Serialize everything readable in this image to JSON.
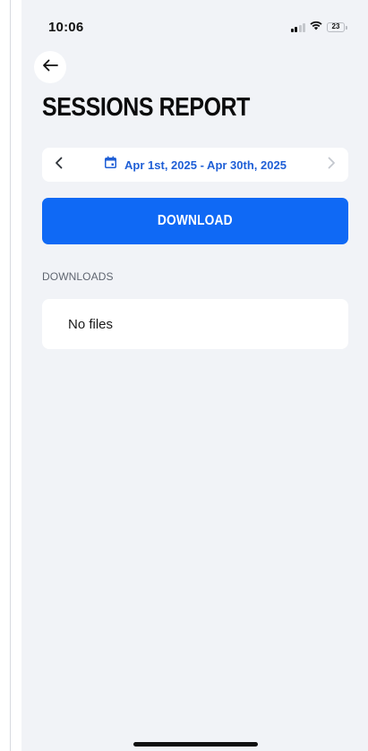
{
  "status_bar": {
    "time": "10:06",
    "battery_percent": "23",
    "battery_level": 0.23,
    "icons": [
      "cellular-signal-icon",
      "wifi-icon",
      "battery-icon"
    ]
  },
  "header": {
    "back_icon": "arrow-left-icon",
    "title": "SESSIONS REPORT"
  },
  "date_range": {
    "label": "Apr 1st, 2025 - Apr 30th, 2025",
    "prev_icon": "chevron-left-icon",
    "next_icon": "chevron-right-icon",
    "calendar_icon": "calendar-icon",
    "next_disabled": true
  },
  "actions": {
    "download_label": "DOWNLOAD"
  },
  "downloads": {
    "section_label": "DOWNLOADS",
    "empty_text": "No files"
  },
  "colors": {
    "accent": "#0f69f5",
    "link": "#1f5fd6",
    "background": "#f1f3f7"
  }
}
